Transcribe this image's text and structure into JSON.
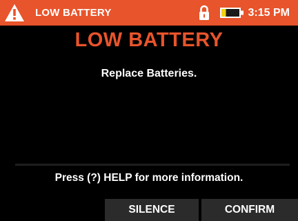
{
  "status_bar": {
    "title": "LOW BATTERY",
    "time": "3:15 PM",
    "icons": [
      "warning-triangle-icon",
      "lock-icon",
      "battery-low-icon"
    ],
    "battery_level": 0.25
  },
  "alarm": {
    "title": "LOW BATTERY",
    "message": "Replace Batteries."
  },
  "help": {
    "text": "Press (?) HELP for more information."
  },
  "softkeys": {
    "silence": "SILENCE",
    "confirm": "CONFIRM"
  },
  "colors": {
    "accent": "#e8542b",
    "background": "#000000",
    "battery_fill": "#f2d40a",
    "softkey_bg": "#2b2b2b"
  }
}
